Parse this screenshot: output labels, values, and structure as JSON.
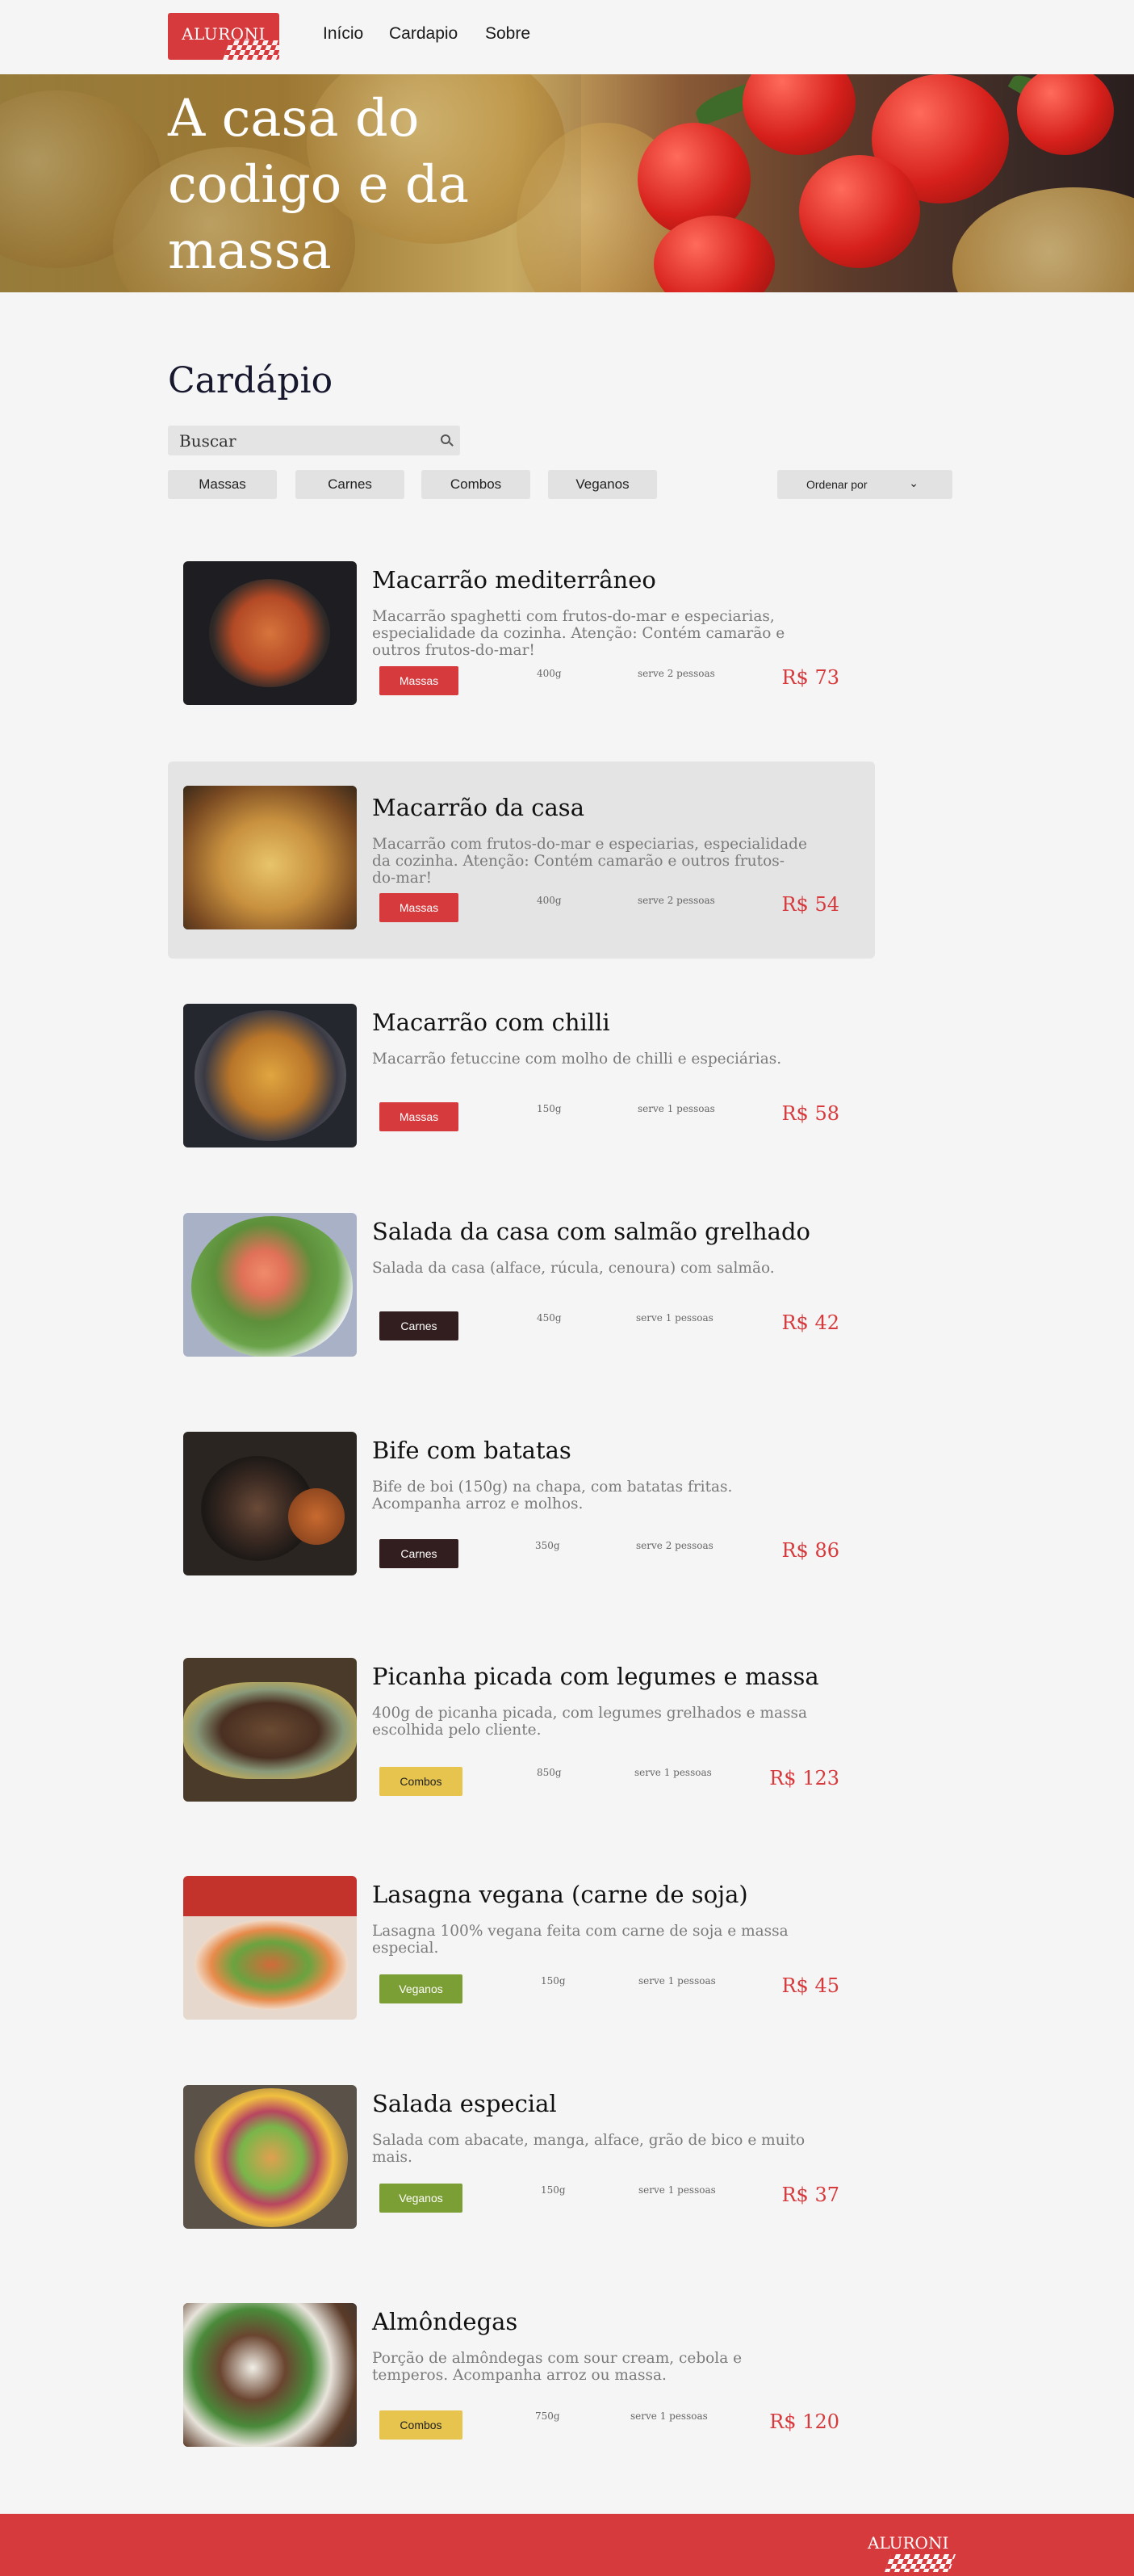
{
  "header": {
    "logo": "ALURONI",
    "nav": [
      "Início",
      "Cardapio",
      "Sobre"
    ]
  },
  "hero": {
    "title": "A casa do codigo e da massa"
  },
  "menu": {
    "title": "Cardápio",
    "search_placeholder": "Buscar",
    "filters": [
      "Massas",
      "Carnes",
      "Combos",
      "Veganos"
    ],
    "sort_label": "Ordenar por",
    "items": [
      {
        "name": "Macarrão mediterrâneo",
        "description": "Macarrão spaghetti com frutos-do-mar e especiarias, especialidade da cozinha. Atenção: Contém camarão e outros frutos-do-mar!",
        "category": "Massas",
        "size": "400g",
        "serves": "serve 2 pessoas",
        "price": "R$ 73"
      },
      {
        "name": "Macarrão da casa",
        "description": "Macarrão com frutos-do-mar e especiarias, especialidade da cozinha. Atenção: Contém camarão e outros frutos-do-mar!",
        "category": "Massas",
        "size": "400g",
        "serves": "serve 2 pessoas",
        "price": "R$ 54"
      },
      {
        "name": "Macarrão com chilli",
        "description": "Macarrão fetuccine com molho de chilli e especiárias.",
        "category": "Massas",
        "size": "150g",
        "serves": "serve 1 pessoas",
        "price": "R$ 58"
      },
      {
        "name": "Salada da casa com salmão grelhado",
        "description": "Salada da casa (alface, rúcula, cenoura) com salmão.",
        "category": "Carnes",
        "size": "450g",
        "serves": "serve 1 pessoas",
        "price": "R$ 42"
      },
      {
        "name": "Bife com batatas",
        "description": "Bife de boi (150g) na chapa, com batatas fritas. Acompanha arroz e molhos.",
        "category": "Carnes",
        "size": "350g",
        "serves": "serve 2 pessoas",
        "price": "R$ 86"
      },
      {
        "name": "Picanha picada com legumes e massa",
        "description": "400g de picanha picada, com legumes grelhados e massa escolhida pelo cliente.",
        "category": "Combos",
        "size": "850g",
        "serves": "serve 1 pessoas",
        "price": "R$ 123"
      },
      {
        "name": "Lasagna vegana (carne de soja)",
        "description": "Lasagna 100% vegana feita com carne de soja e massa especial.",
        "category": "Veganos",
        "size": "150g",
        "serves": "serve 1 pessoas",
        "price": "R$ 45"
      },
      {
        "name": "Salada especial",
        "description": "Salada com abacate, manga, alface, grão de bico e muito mais.",
        "category": "Veganos",
        "size": "150g",
        "serves": "serve 1 pessoas",
        "price": "R$ 37"
      },
      {
        "name": "Almôndegas",
        "description": "Porção de almôndegas com sour cream, cebola e temperos. Acompanha arroz ou massa.",
        "category": "Combos",
        "size": "750g",
        "serves": "serve 1 pessoas",
        "price": "R$ 120"
      }
    ]
  },
  "footer": {
    "logo": "ALURONI"
  },
  "colors": {
    "brand_red": "#d73a3d",
    "carnes": "#321e1f",
    "combos": "#e6c44e",
    "veganos": "#7c9f35"
  }
}
